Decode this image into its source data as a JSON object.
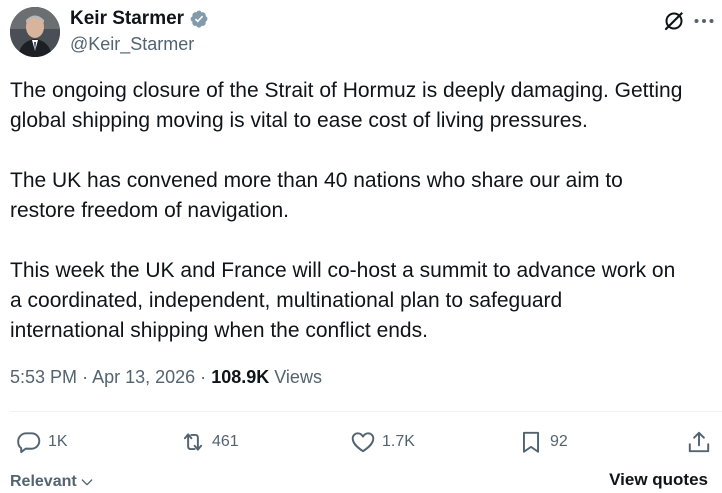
{
  "author": {
    "display_name": "Keir Starmer",
    "handle": "@Keir_Starmer",
    "verified": true
  },
  "tweet": {
    "paragraphs": [
      "The ongoing closure of the Strait of Hormuz is deeply damaging. Getting\nglobal shipping moving is vital to ease cost of living pressures.",
      "The UK has convened more than 40 nations who share our aim to\nrestore freedom of navigation.",
      "This week the UK and France will co-host a summit to advance work on\na coordinated, independent, multinational plan to safeguard\ninternational shipping when the conflict ends."
    ],
    "time": "5:53 PM",
    "separator": "·",
    "date": "Apr 13, 2026",
    "views_count": "108.9K",
    "views_label": "Views"
  },
  "actions": {
    "replies": "1K",
    "reposts": "461",
    "likes": "1.7K",
    "bookmarks": "92"
  },
  "footer": {
    "sort_label": "Relevant",
    "view_quotes_label": "View quotes"
  },
  "icons": {
    "verified": "verified-badge-icon",
    "grok": "grok-icon",
    "reply": "reply-icon",
    "repost": "repost-icon",
    "like": "heart-icon",
    "bookmark": "bookmark-icon",
    "share": "share-icon",
    "chevron": "chevron-down-icon"
  },
  "colors": {
    "text_primary": "#0f1419",
    "text_secondary": "#536471",
    "divider": "#eff3f4",
    "verified": "#829aab"
  }
}
